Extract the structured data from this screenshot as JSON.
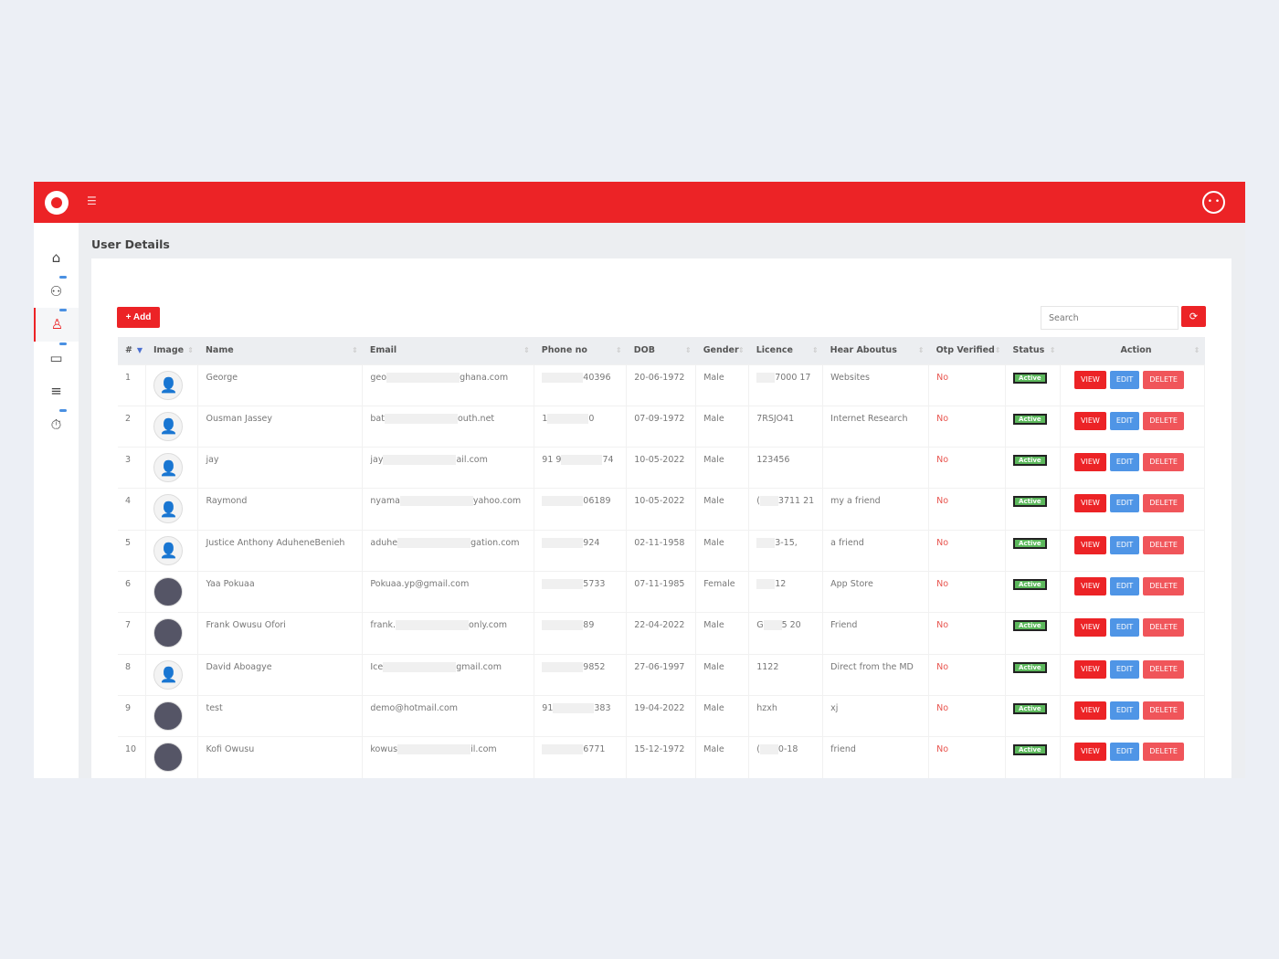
{
  "header": {
    "menu_icon": "hamburger-icon",
    "user_icon": "user-circle-icon",
    "brand_color": "#ec2326"
  },
  "sidebar": {
    "items": [
      {
        "icon": "home-icon"
      },
      {
        "icon": "users-icon"
      },
      {
        "icon": "user-icon",
        "active": true
      },
      {
        "icon": "monitor-icon"
      },
      {
        "icon": "list-icon"
      },
      {
        "icon": "timer-icon"
      }
    ]
  },
  "page": {
    "title": "User Details"
  },
  "toolbar": {
    "add_label": "+ Add",
    "search_placeholder": "Search",
    "refresh_icon": "refresh-icon"
  },
  "table": {
    "columns": [
      "#",
      "Image",
      "Name",
      "Email",
      "Phone no",
      "DOB",
      "Gender",
      "Licence",
      "Hear Aboutus",
      "Otp Verified",
      "Status",
      "Action"
    ],
    "actions": {
      "view": "VIEW",
      "edit": "EDIT",
      "delete": "DELETE"
    },
    "rows": [
      {
        "n": "1",
        "photo": false,
        "name": "George",
        "email": [
          "geo",
          "ghana.com"
        ],
        "phone": [
          "",
          "40396"
        ],
        "dob": "20-06-1972",
        "gender": "Male",
        "licence": [
          "",
          "7000 17"
        ],
        "hear": "Websites",
        "otp": "No",
        "status": "Active"
      },
      {
        "n": "2",
        "photo": false,
        "name": "Ousman Jassey",
        "email": [
          "bat",
          "outh.net"
        ],
        "phone": [
          "1",
          "0"
        ],
        "dob": "07-09-1972",
        "gender": "Male",
        "licence": [
          "7RSJO41"
        ],
        "hear": "Internet Research",
        "otp": "No",
        "status": "Active"
      },
      {
        "n": "3",
        "photo": false,
        "name": "jay",
        "email": [
          "jay",
          "ail.com"
        ],
        "phone": [
          "91 9",
          "74"
        ],
        "dob": "10-05-2022",
        "gender": "Male",
        "licence": [
          "123456"
        ],
        "hear": "",
        "otp": "No",
        "status": "Active"
      },
      {
        "n": "4",
        "photo": false,
        "name": "Raymond",
        "email": [
          "nyama",
          "yahoo.com"
        ],
        "phone": [
          "",
          "06189"
        ],
        "dob": "10-05-2022",
        "gender": "Male",
        "licence": [
          "(",
          "3711 21"
        ],
        "hear": "my a friend",
        "otp": "No",
        "status": "Active"
      },
      {
        "n": "5",
        "photo": false,
        "name": "Justice Anthony AduheneBenieh",
        "email": [
          "aduhe",
          "gation.com"
        ],
        "phone": [
          "",
          "924"
        ],
        "dob": "02-11-1958",
        "gender": "Male",
        "licence": [
          "",
          "3-15,"
        ],
        "hear": "a friend",
        "otp": "No",
        "status": "Active"
      },
      {
        "n": "6",
        "photo": true,
        "name": "Yaa Pokuaa",
        "email": [
          "Pokuaa.yp@gmail.com"
        ],
        "phone": [
          "",
          "5733"
        ],
        "dob": "07-11-1985",
        "gender": "Female",
        "licence": [
          "",
          "12"
        ],
        "hear": "App Store",
        "otp": "No",
        "status": "Active"
      },
      {
        "n": "7",
        "photo": true,
        "name": "Frank Owusu Ofori",
        "email": [
          "frank.",
          "only.com"
        ],
        "phone": [
          "",
          "89"
        ],
        "dob": "22-04-2022",
        "gender": "Male",
        "licence": [
          "G",
          "5 20"
        ],
        "hear": "Friend",
        "otp": "No",
        "status": "Active"
      },
      {
        "n": "8",
        "photo": false,
        "name": "David Aboagye",
        "email": [
          "Ice",
          "gmail.com"
        ],
        "phone": [
          "",
          "9852"
        ],
        "dob": "27-06-1997",
        "gender": "Male",
        "licence": [
          "1122"
        ],
        "hear": "Direct from the MD",
        "otp": "No",
        "status": "Active"
      },
      {
        "n": "9",
        "photo": true,
        "name": "test",
        "email": [
          "demo@hotmail.com"
        ],
        "phone": [
          "91",
          "383"
        ],
        "dob": "19-04-2022",
        "gender": "Male",
        "licence": [
          "hzxh"
        ],
        "hear": "xj",
        "otp": "No",
        "status": "Active"
      },
      {
        "n": "10",
        "photo": true,
        "name": "Kofi Owusu",
        "email": [
          "kowus",
          "il.com"
        ],
        "phone": [
          "",
          "6771"
        ],
        "dob": "15-12-1972",
        "gender": "Male",
        "licence": [
          "(",
          "0-18"
        ],
        "hear": "friend",
        "otp": "No",
        "status": "Active"
      }
    ]
  }
}
